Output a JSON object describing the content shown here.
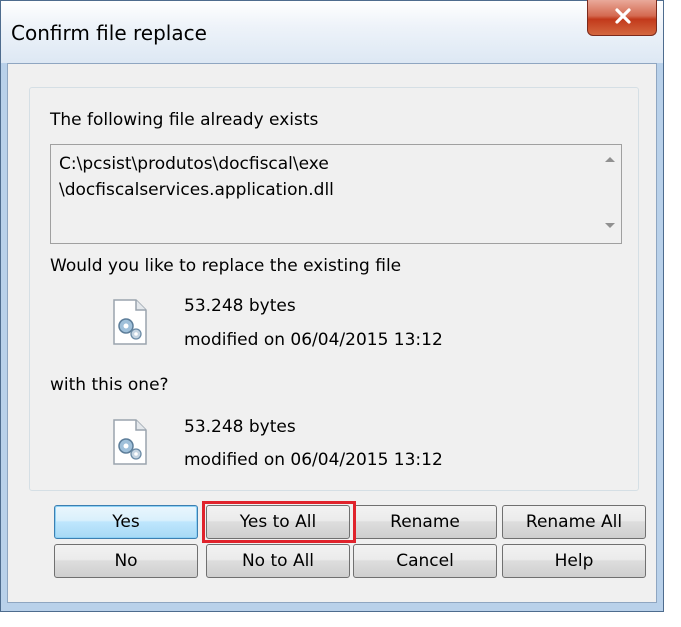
{
  "dialog": {
    "title": "Confirm file replace"
  },
  "message": {
    "exists_label": "The following file already exists",
    "path_line1": "C:\\pcsist\\produtos\\docfiscal\\exe",
    "path_line2": "\\docfiscalservices.application.dll",
    "replace_question": "Would you like to replace the existing file",
    "with_label": "with this one?"
  },
  "existing_file": {
    "size": "53.248 bytes",
    "modified": "modified on 06/04/2015 13:12"
  },
  "new_file": {
    "size": "53.248 bytes",
    "modified": "modified on 06/04/2015 13:12"
  },
  "buttons": {
    "yes": "Yes",
    "yes_to_all": "Yes to All",
    "rename": "Rename",
    "rename_all": "Rename All",
    "no": "No",
    "no_to_all": "No to All",
    "cancel": "Cancel",
    "help": "Help"
  },
  "icons": {
    "close": "close-icon",
    "file": "settings-file-icon",
    "scroll_up": "arrow-up-icon",
    "scroll_down": "arrow-down-icon"
  },
  "colors": {
    "highlight": "#e0232c",
    "close_button": "#c2391b",
    "title_bar": "#dde8f4"
  }
}
